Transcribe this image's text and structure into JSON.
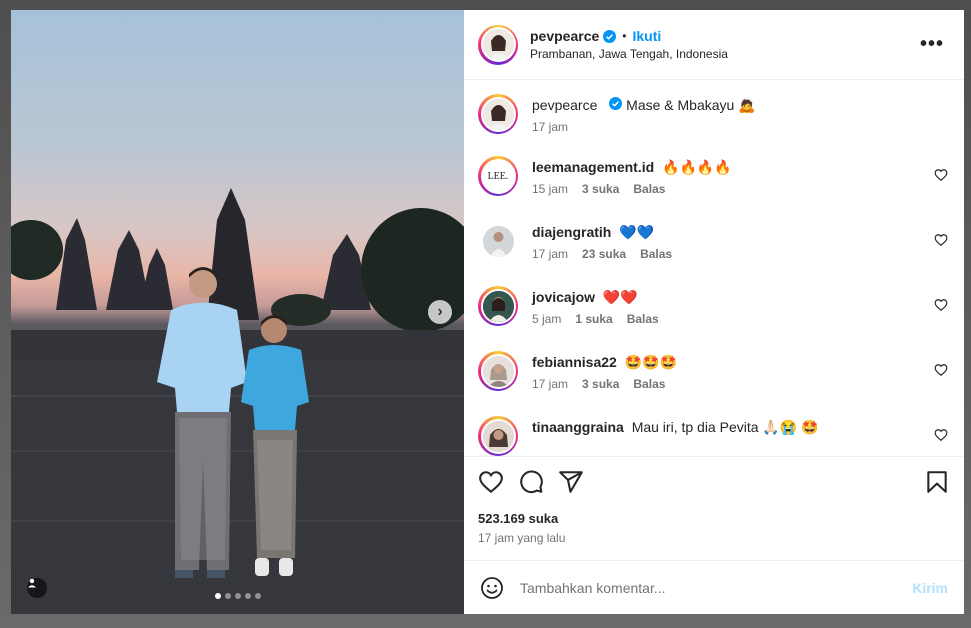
{
  "post": {
    "username": "pevpearce",
    "follow_label": "Ikuti",
    "separator": "•",
    "location": "Prambanan, Jawa Tengah, Indonesia",
    "more_label": "•••",
    "likes": "523.169 suka",
    "time_ago": "17 jam yang lalu",
    "carousel": {
      "slide_count": 5,
      "active_index": 0
    }
  },
  "caption": {
    "username": "pevpearce",
    "text": "Mase & Mbakayu 🙇",
    "time": "17 jam"
  },
  "comments": [
    {
      "username": "leemanagement.id",
      "text": "🔥🔥🔥🔥",
      "time": "15 jam",
      "likes": "3 suka",
      "reply": "Balas",
      "avatar_label": "LEE.",
      "ring": true
    },
    {
      "username": "diajengratih",
      "text": "💙💙",
      "time": "17 jam",
      "likes": "23 suka",
      "reply": "Balas",
      "ring": false
    },
    {
      "username": "jovicajow",
      "text": "❤️❤️",
      "time": "5 jam",
      "likes": "1 suka",
      "reply": "Balas",
      "ring": true
    },
    {
      "username": "febiannisa22",
      "text": "🤩🤩🤩",
      "time": "17 jam",
      "likes": "3 suka",
      "reply": "Balas",
      "ring": true
    },
    {
      "username": "tinaanggraina",
      "text": "Mau iri, tp dia Pevita 🙏🏻😭 🤩",
      "time": "",
      "likes": "",
      "reply": "",
      "ring": true
    }
  ],
  "composer": {
    "placeholder": "Tambahkan komentar...",
    "post_label": "Kirim"
  },
  "icons": {
    "verified": "verified-badge-icon",
    "like": "heart-icon",
    "comment": "comment-icon",
    "share": "send-icon",
    "save": "bookmark-icon",
    "emoji": "emoji-icon",
    "next": "chevron-right-icon",
    "tag": "user-tag-icon"
  },
  "colors": {
    "accent": "#0095f6",
    "post_disabled": "#b2dffc",
    "text": "#262626",
    "muted": "#737373"
  }
}
